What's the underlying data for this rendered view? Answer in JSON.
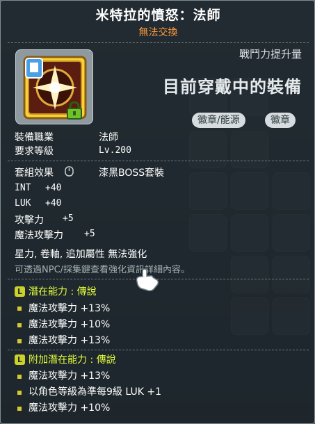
{
  "item": {
    "title": "米特拉的憤怒：法師",
    "trade_status": "無法交換",
    "icon": "emblem-badge-icon",
    "lock_icon": "padlock-icon"
  },
  "compare": {
    "power_up_label": "戰鬥力提升量",
    "equipped_label": "目前穿戴中的裝備",
    "tags": [
      "徽章/能源",
      "徽章"
    ]
  },
  "requirements": {
    "job_label": "裝備職業",
    "job_value": "法師",
    "level_label": "要求等級",
    "level_value": "Lv.200"
  },
  "set_effect": {
    "label": "套組效果",
    "value": "漆黑BOSS套裝",
    "icon": "set-info-icon"
  },
  "stats": [
    {
      "name": "INT",
      "value": "+40"
    },
    {
      "name": "LUK",
      "value": "+40"
    },
    {
      "name": "攻擊力",
      "value": "+5"
    },
    {
      "name": "魔法攻擊力",
      "value": "+5"
    }
  ],
  "notes": {
    "restrictions": "星力, 卷軸, 追加屬性 無法強化",
    "hint": "可透過NPC/採集鍵查看強化資訊詳細內容。"
  },
  "potential": {
    "grade_icon": "L",
    "title": "潛在能力 : 傳說",
    "lines": [
      "魔法攻擊力 +13%",
      "魔法攻擊力 +10%",
      "魔法攻擊力 +13%"
    ]
  },
  "bonus_potential": {
    "grade_icon": "L",
    "title": "附加潛在能力 : 傳說",
    "lines": [
      "魔法攻擊力 +13%",
      "以角色等級為準每9級 LUK +1",
      "魔法攻擊力 +10%"
    ]
  },
  "colors": {
    "title": "#ffffff",
    "trade_status": "#ff9a3c",
    "potential": "#e6ff3c",
    "hint": "#a9b2b6"
  },
  "cursor": "hand-pointer-icon"
}
